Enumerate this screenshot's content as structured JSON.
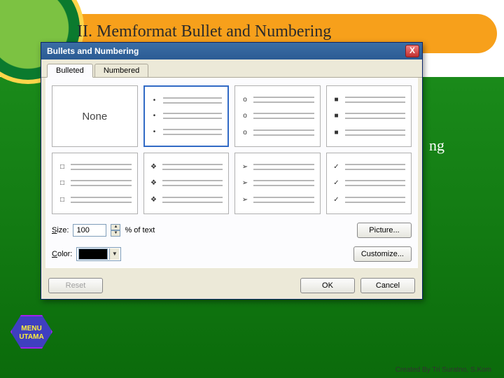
{
  "slide": {
    "heading": "II. Memformat Bullet and Numbering",
    "peek_text": "ng",
    "menu_utama_l1": "MENU",
    "menu_utama_l2": "UTAMA",
    "credit": "Created By Tri Suratno, S.Kom"
  },
  "dialog": {
    "title": "Bullets and Numbering",
    "close": "X",
    "tabs": {
      "bulleted": "Bulleted",
      "numbered": "Numbered"
    },
    "none_label": "None",
    "bullet_chars": {
      "dot": "•",
      "ring": "o",
      "black_sq": "■",
      "hollow_sq": "□",
      "diamond": "❖",
      "tri": "➢",
      "check": "✓"
    },
    "labels": {
      "size": "Size:",
      "pct_of_text": "% of text",
      "color": "Color:"
    },
    "size_value": "100",
    "buttons": {
      "picture": "Picture...",
      "customize": "Customize...",
      "reset": "Reset",
      "ok": "OK",
      "cancel": "Cancel"
    }
  }
}
